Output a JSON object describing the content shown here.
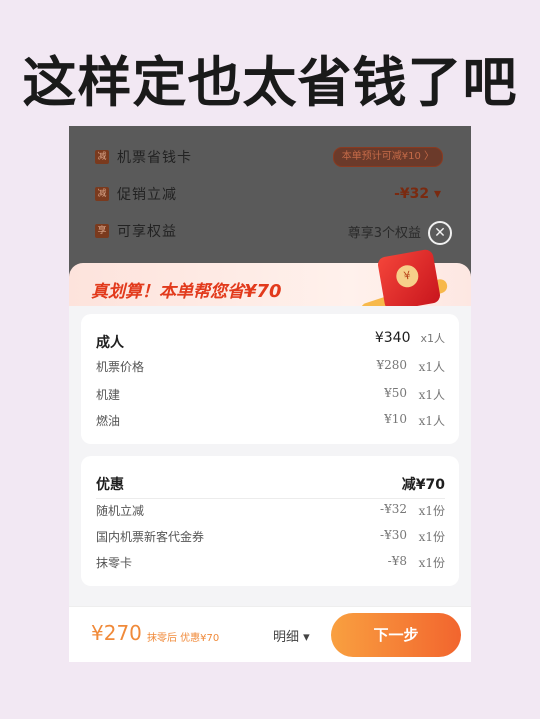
{
  "headline": "这样定也太省钱了吧",
  "top_panel": {
    "row1": {
      "tag": "减",
      "label": "机票省钱卡",
      "pill": "本单预计可减¥10 〉"
    },
    "row2": {
      "tag": "减",
      "label": "促销立减",
      "value": "-¥32 ▾"
    },
    "row3": {
      "tag": "享",
      "label": "可享权益",
      "value": "尊享3个权益"
    },
    "close_icon": "close-icon"
  },
  "banner": {
    "title_prefix": "真划算！本单帮您省",
    "amount": "¥70",
    "coin_mark": "¥"
  },
  "adult_card": {
    "title": "成人",
    "total": "¥340",
    "total_qty": "x1人",
    "items": [
      {
        "label": "机票价格",
        "value": "¥280",
        "qty": "x1人"
      },
      {
        "label": "机建",
        "value": "¥50",
        "qty": "x1人"
      },
      {
        "label": "燃油",
        "value": "¥10",
        "qty": "x1人"
      }
    ]
  },
  "discount_card": {
    "title": "优惠",
    "total": "减¥70",
    "items": [
      {
        "label": "随机立减",
        "value": "-¥32",
        "qty": "x1份"
      },
      {
        "label": "国内机票新客代金券",
        "value": "-¥30",
        "qty": "x1份"
      },
      {
        "label": "抹零卡",
        "value": "-¥8",
        "qty": "x1份"
      }
    ]
  },
  "bottom_bar": {
    "total": "¥270",
    "note": "抹零后 优惠¥70",
    "detail_label": "明细 ▾",
    "next_label": "下一步"
  },
  "colors": {
    "accent": "#f2652e",
    "discount_red": "#e23a1c",
    "price_orange": "#f08a3a"
  }
}
